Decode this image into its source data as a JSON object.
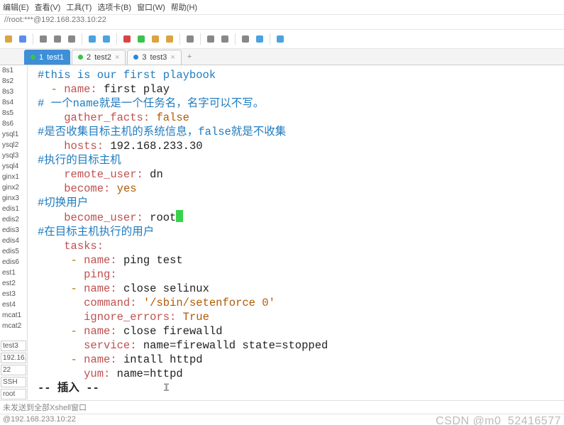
{
  "menu": {
    "items": [
      "编辑(E)",
      "查看(V)",
      "工具(T)",
      "选项卡(B)",
      "窗口(W)",
      "帮助(H)"
    ]
  },
  "addressbar": "//root:***@192.168.233.10:22",
  "toolbar_icons": [
    "open",
    "save",
    "sep",
    "copy",
    "paste",
    "find",
    "sep",
    "highlight",
    "color",
    "sep",
    "record",
    "stop",
    "upload",
    "download",
    "sep",
    "user",
    "sep",
    "screen",
    "grid",
    "sep",
    "settings",
    "help",
    "sep",
    "bubble"
  ],
  "tabs": [
    {
      "num": "1",
      "label": "test1",
      "dot": "#3ac24c",
      "active": true
    },
    {
      "num": "2",
      "label": "test2",
      "dot": "#3ac24c",
      "active": false
    },
    {
      "num": "3",
      "label": "test3",
      "dot": "#2a88d8",
      "active": false
    }
  ],
  "sidebar": {
    "items": [
      "8s1",
      "8s2",
      "8s3",
      "8s4",
      "8s5",
      "8s6",
      "ysql1",
      "ysql2",
      "ysql3",
      "ysql4",
      "ginx1",
      "ginx2",
      "ginx3",
      "edis1",
      "edis2",
      "edis3",
      "edis4",
      "edis5",
      "edis6",
      "est1",
      "est2",
      "est3",
      "est4",
      "mcat1",
      "mcat2"
    ],
    "boxed": [
      "test3",
      "192.16...",
      "22",
      "SSH",
      "root"
    ]
  },
  "code": [
    {
      "segs": [
        {
          "c": "cmt",
          "t": "#this is our first playbook"
        }
      ]
    },
    {
      "segs": [
        {
          "c": "",
          "t": "  "
        },
        {
          "c": "dash",
          "t": "-"
        },
        {
          "c": "",
          "t": " "
        },
        {
          "c": "key",
          "t": "name:"
        },
        {
          "c": "",
          "t": " "
        },
        {
          "c": "val",
          "t": "first play"
        }
      ]
    },
    {
      "segs": [
        {
          "c": "cmt",
          "t": "# 一个name就是一个任务名，名字可以不写。"
        }
      ]
    },
    {
      "segs": [
        {
          "c": "",
          "t": "    "
        },
        {
          "c": "key",
          "t": "gather_facts:"
        },
        {
          "c": "",
          "t": " "
        },
        {
          "c": "kw",
          "t": "false"
        }
      ]
    },
    {
      "segs": [
        {
          "c": "cmt",
          "t": "#是否收集目标主机的系统信息，false就是不收集"
        }
      ]
    },
    {
      "segs": [
        {
          "c": "",
          "t": "    "
        },
        {
          "c": "key",
          "t": "hosts:"
        },
        {
          "c": "",
          "t": " "
        },
        {
          "c": "val",
          "t": "192.168.233.30"
        }
      ]
    },
    {
      "segs": [
        {
          "c": "cmt",
          "t": "#执行的目标主机"
        }
      ]
    },
    {
      "segs": [
        {
          "c": "",
          "t": "    "
        },
        {
          "c": "key",
          "t": "remote_user:"
        },
        {
          "c": "",
          "t": " "
        },
        {
          "c": "val",
          "t": "dn"
        }
      ]
    },
    {
      "segs": [
        {
          "c": "",
          "t": "    "
        },
        {
          "c": "key",
          "t": "become:"
        },
        {
          "c": "",
          "t": " "
        },
        {
          "c": "kw",
          "t": "yes"
        }
      ]
    },
    {
      "segs": [
        {
          "c": "cmt",
          "t": "#切换用户"
        }
      ]
    },
    {
      "segs": [
        {
          "c": "",
          "t": "    "
        },
        {
          "c": "key",
          "t": "become_user:"
        },
        {
          "c": "",
          "t": " "
        },
        {
          "c": "val",
          "t": "root"
        },
        {
          "c": "cursor",
          "t": ""
        }
      ]
    },
    {
      "segs": [
        {
          "c": "cmt",
          "t": "#在目标主机执行的用户"
        }
      ]
    },
    {
      "segs": [
        {
          "c": "",
          "t": "    "
        },
        {
          "c": "key",
          "t": "tasks:"
        }
      ]
    },
    {
      "segs": [
        {
          "c": "",
          "t": "     "
        },
        {
          "c": "dash",
          "t": "-"
        },
        {
          "c": "",
          "t": " "
        },
        {
          "c": "key",
          "t": "name:"
        },
        {
          "c": "",
          "t": " "
        },
        {
          "c": "val",
          "t": "ping test"
        }
      ]
    },
    {
      "segs": [
        {
          "c": "",
          "t": "       "
        },
        {
          "c": "key",
          "t": "ping:"
        }
      ]
    },
    {
      "segs": [
        {
          "c": "",
          "t": "     "
        },
        {
          "c": "dash",
          "t": "-"
        },
        {
          "c": "",
          "t": " "
        },
        {
          "c": "key",
          "t": "name:"
        },
        {
          "c": "",
          "t": " "
        },
        {
          "c": "val",
          "t": "close selinux"
        }
      ]
    },
    {
      "segs": [
        {
          "c": "",
          "t": "       "
        },
        {
          "c": "key",
          "t": "command:"
        },
        {
          "c": "",
          "t": " "
        },
        {
          "c": "str",
          "t": "'/sbin/setenforce 0'"
        }
      ]
    },
    {
      "segs": [
        {
          "c": "",
          "t": "       "
        },
        {
          "c": "key",
          "t": "ignore_errors:"
        },
        {
          "c": "",
          "t": " "
        },
        {
          "c": "kw",
          "t": "True"
        }
      ]
    },
    {
      "segs": [
        {
          "c": "",
          "t": "     "
        },
        {
          "c": "dash",
          "t": "-"
        },
        {
          "c": "",
          "t": " "
        },
        {
          "c": "key",
          "t": "name:"
        },
        {
          "c": "",
          "t": " "
        },
        {
          "c": "val",
          "t": "close firewalld"
        }
      ]
    },
    {
      "segs": [
        {
          "c": "",
          "t": "       "
        },
        {
          "c": "key",
          "t": "service:"
        },
        {
          "c": "",
          "t": " "
        },
        {
          "c": "val",
          "t": "name=firewalld state=stopped"
        }
      ]
    },
    {
      "segs": [
        {
          "c": "",
          "t": "     "
        },
        {
          "c": "dash",
          "t": "-"
        },
        {
          "c": "",
          "t": " "
        },
        {
          "c": "key",
          "t": "name:"
        },
        {
          "c": "",
          "t": " "
        },
        {
          "c": "val",
          "t": "intall httpd"
        }
      ]
    },
    {
      "segs": [
        {
          "c": "",
          "t": "       "
        },
        {
          "c": "key",
          "t": "yum:"
        },
        {
          "c": "",
          "t": " "
        },
        {
          "c": "val",
          "t": "name=httpd"
        }
      ]
    }
  ],
  "statusline": "-- 插入 --",
  "footer1": "未发送到全部Xshell窗口",
  "footer2_left": "@192.168.233.10:22",
  "watermark": "CSDN @m0_52416577"
}
